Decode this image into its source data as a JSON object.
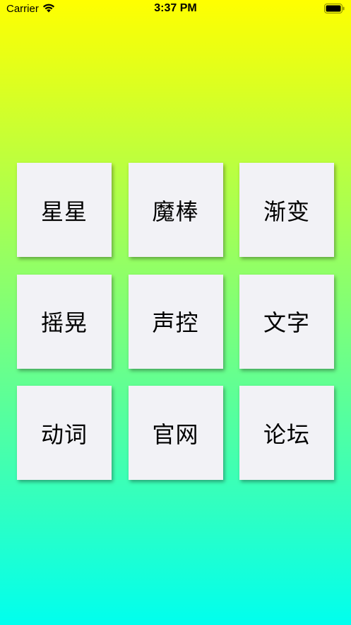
{
  "status_bar": {
    "carrier": "Carrier",
    "time": "3:37 PM",
    "wifi_icon": "wifi-icon",
    "battery_icon": "battery-full-icon"
  },
  "background": {
    "gradient_top": "#ffff00",
    "gradient_bottom": "#00ffee"
  },
  "tiles": [
    {
      "label": "星星"
    },
    {
      "label": "魔棒"
    },
    {
      "label": "渐变"
    },
    {
      "label": "摇晃"
    },
    {
      "label": "声控"
    },
    {
      "label": "文字"
    },
    {
      "label": "动词"
    },
    {
      "label": "官网"
    },
    {
      "label": "论坛"
    }
  ],
  "colors": {
    "tile_background": "#f2f2f6",
    "tile_text": "#000000"
  }
}
